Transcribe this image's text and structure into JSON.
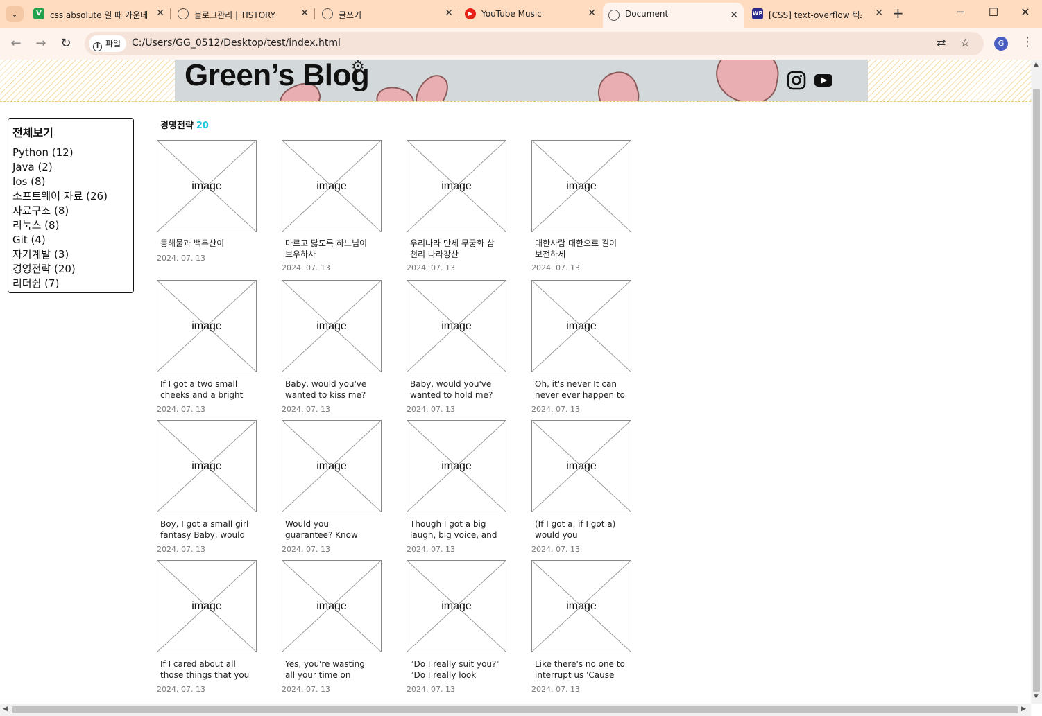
{
  "browser": {
    "tabs": [
      {
        "title": "css absolute 일 때 가운데",
        "favicon": "V",
        "color": "#23a24d"
      },
      {
        "title": "블로그관리 | TISTORY",
        "favicon": "globe",
        "color": "#555555"
      },
      {
        "title": "글쓰기",
        "favicon": "globe",
        "color": "#555555"
      },
      {
        "title": "YouTube Music",
        "favicon": "youtube-music",
        "color": "#e62117"
      },
      {
        "title": "Document",
        "favicon": "globe",
        "color": "#555555"
      },
      {
        "title": "[CSS] text-overflow 텍스",
        "favicon": "WP",
        "color": "#2a2a8c"
      }
    ],
    "address_chip": "파일",
    "url": "C:/Users/GG_0512/Desktop/test/index.html",
    "profile_initial": "G"
  },
  "blog": {
    "title": "Green’s Blog",
    "sidebar": {
      "title": "전체보기",
      "categories": [
        "Python (12)",
        "Java (2)",
        "Ios (8)",
        "소프트웨어 자료 (26)",
        "자료구조 (8)",
        "리눅스 (8)",
        "Git (4)",
        "자기계발 (3)",
        "경영전략 (20)",
        "리더쉽 (7)"
      ]
    },
    "section": {
      "name": "경영전략",
      "count": "20"
    },
    "image_label": "image",
    "posts": [
      {
        "title": "동해물과 백두산이",
        "date": "2024. 07. 13"
      },
      {
        "title": "마르고 닳도록 하느님이 보우하사",
        "date": "2024. 07. 13"
      },
      {
        "title": "우리나라 만세 무궁화 삼천리 나라강산",
        "date": "2024. 07. 13"
      },
      {
        "title": "대한사람 대한으로 길이 보전하세",
        "date": "2024. 07. 13"
      },
      {
        "title": "If I got a two small cheeks and a bright",
        "date": "2024. 07. 13"
      },
      {
        "title": "Baby, would you've wanted to kiss me?",
        "date": "2024. 07. 13"
      },
      {
        "title": "Baby, would you've wanted to hold me? No,",
        "date": "2024. 07. 13"
      },
      {
        "title": "Oh, it's never It can never ever happen to",
        "date": "2024. 07. 13"
      },
      {
        "title": "Boy, I got a small girl fantasy Baby, would you",
        "date": "2024. 07. 13"
      },
      {
        "title": "Would you guarantee? Know you got a small",
        "date": "2024. 07. 13"
      },
      {
        "title": "Though I got a big laugh, big voice, and",
        "date": "2024. 07. 13"
      },
      {
        "title": "(If I got a, if I got a) would you guarantee?",
        "date": "2024. 07. 13"
      },
      {
        "title": "If I cared about all those things that you care",
        "date": "2024. 07. 13"
      },
      {
        "title": "Yes, you're wasting all your time on some",
        "date": "2024. 07. 13"
      },
      {
        "title": "\"Do I really suit you?\" \"Do I really look good?\"",
        "date": "2024. 07. 13"
      },
      {
        "title": "Like there's no one to interrupt us 'Cause",
        "date": "2024. 07. 13"
      }
    ]
  }
}
